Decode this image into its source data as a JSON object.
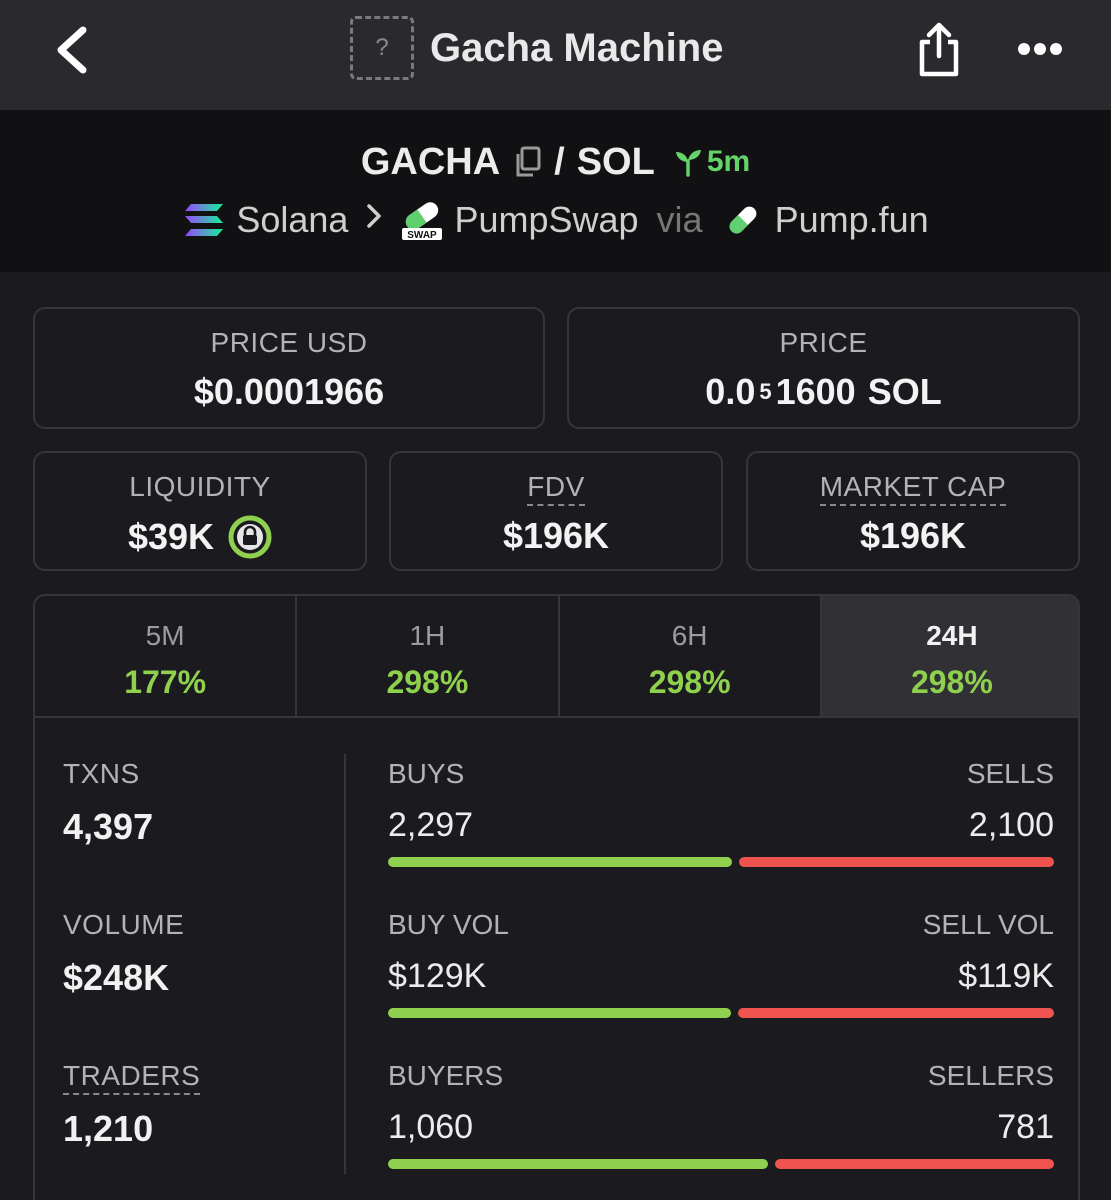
{
  "header": {
    "title": "Gacha Machine",
    "token_placeholder_glyph": "?"
  },
  "pair": {
    "base": "GACHA",
    "separator": "/",
    "quote": "SOL",
    "age": "5m"
  },
  "route": {
    "chain": "Solana",
    "dex": "PumpSwap",
    "dex_badge": "SWAP",
    "via_label": "via",
    "launchpad": "Pump.fun"
  },
  "price_usd": {
    "label": "PRICE USD",
    "value": "$0.0001966"
  },
  "price_native": {
    "label": "PRICE",
    "prefix": "0.0",
    "zero_count": "5",
    "digits": "1600",
    "unit": "SOL"
  },
  "liquidity": {
    "label": "LIQUIDITY",
    "value": "$39K"
  },
  "fdv": {
    "label": "FDV",
    "value": "$196K"
  },
  "market_cap": {
    "label": "MARKET CAP",
    "value": "$196K"
  },
  "timeframes": [
    {
      "label": "5M",
      "change": "177%"
    },
    {
      "label": "1H",
      "change": "298%"
    },
    {
      "label": "6H",
      "change": "298%"
    },
    {
      "label": "24H",
      "change": "298%"
    }
  ],
  "active_timeframe": "24H",
  "metrics": {
    "txns": {
      "label": "TXNS",
      "value": "4,397",
      "buys_label": "BUYS",
      "buys": "2,297",
      "sells_label": "SELLS",
      "sells": "2,100",
      "buy_fraction": 0.522
    },
    "volume": {
      "label": "VOLUME",
      "value": "$248K",
      "buys_label": "BUY VOL",
      "buys": "$129K",
      "sells_label": "SELL VOL",
      "sells": "$119K",
      "buy_fraction": 0.52
    },
    "traders": {
      "label": "TRADERS",
      "value": "1,210",
      "buys_label": "BUYERS",
      "buys": "1,060",
      "sells_label": "SELLERS",
      "sells": "781",
      "buy_fraction": 0.576
    }
  },
  "colors": {
    "positive": "#8fd14f",
    "negative": "#ef5350",
    "age_badge": "#63d36a",
    "lock_badge": "#8fd14f"
  }
}
